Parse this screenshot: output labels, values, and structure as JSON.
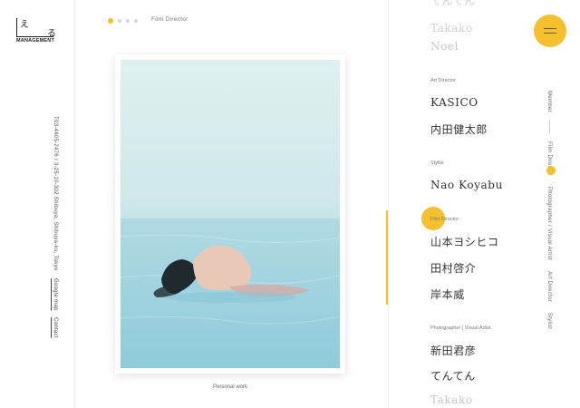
{
  "logo": {
    "glyph1": "え",
    "glyph2": "る",
    "word": "MANAGEMENT"
  },
  "left": {
    "address": "T03-4405-2476 / 3-25-10-302 Shibuya, Shibuya-ku, Tokyo",
    "google_map": "Google map",
    "contact": "Contact"
  },
  "top": {
    "label": "Film Director"
  },
  "photo": {
    "caption": "Personal work"
  },
  "list": {
    "top_cut": "てんてん",
    "faded1": "Takako",
    "faded2": "Noel",
    "cat_art": "Art Director",
    "kasico": "KASICO",
    "uchida": "内田健太郎",
    "cat_stylist": "Stylist",
    "nao": "Nao Koyabu",
    "cat_film": "Film Director",
    "yamamoto": "山本ヨシヒコ",
    "tamura": "田村啓介",
    "kishimoto": "岸本威",
    "cat_photo": "Photographer | Visual Artist",
    "shinda": "新田君彦",
    "tenten": "てんてん",
    "takako": "Takako"
  },
  "nav": {
    "member": "Member",
    "film": "Film Director",
    "photographer": "Photographer / Visual Artist",
    "art": "Art Director",
    "stylist": "Stylist"
  },
  "colors": {
    "accent": "#f5c02d"
  }
}
